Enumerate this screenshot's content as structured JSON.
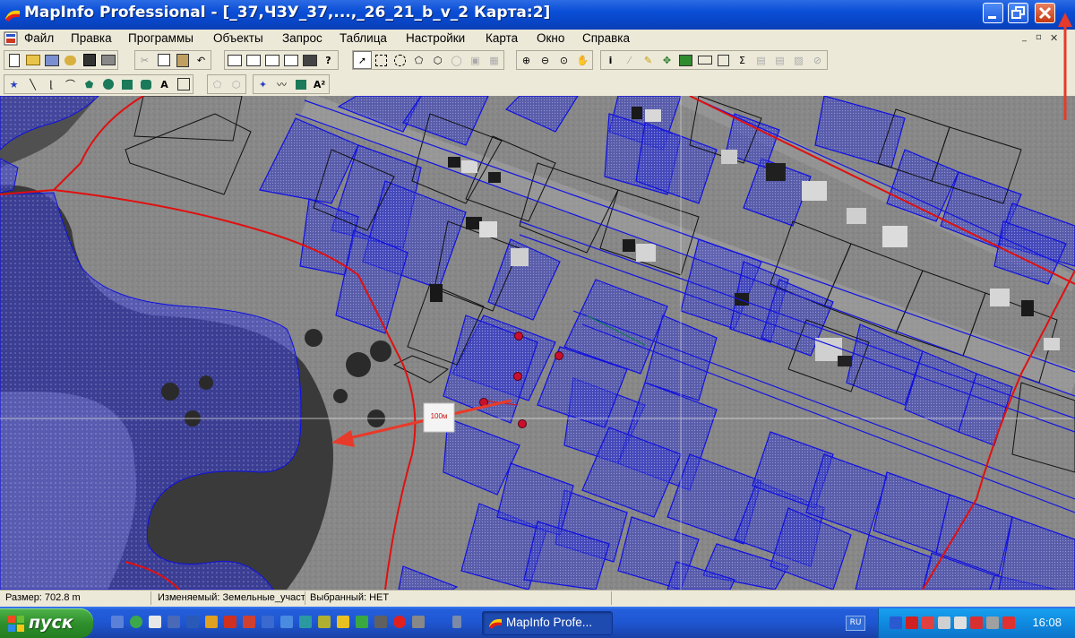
{
  "window": {
    "title": "MapInfo Professional - [_37,ЧЗУ_37,...,_26_21_b_v_2 Карта:2]"
  },
  "menu": [
    "Файл",
    "Правка",
    "Программы",
    "Объекты",
    "Запрос",
    "Таблица",
    "Настройки",
    "Карта",
    "Окно",
    "Справка"
  ],
  "map": {
    "distance_label": "100м"
  },
  "status": {
    "size": "Размер: 702.8 m",
    "editable": "Изменяемый: Земельные_участ",
    "selected": "Выбранный: НЕТ"
  },
  "taskbar": {
    "start_label": "пуск",
    "task_label": "MapInfo Profe...",
    "lang": "RU",
    "clock": "16:08"
  },
  "colors": {
    "title_bar": "#0a4ed6",
    "parcel_fill": "#2a2fd0",
    "parcel_stroke": "#1010e0",
    "boundary_red": "#e01010",
    "annotation_arrow": "#e83a2a",
    "taskbar": "#245edb",
    "start_button": "#3a9a36"
  },
  "icons": {
    "title_close": "close-icon",
    "title_maximize": "restore-icon",
    "title_minimize": "minimize-icon"
  }
}
